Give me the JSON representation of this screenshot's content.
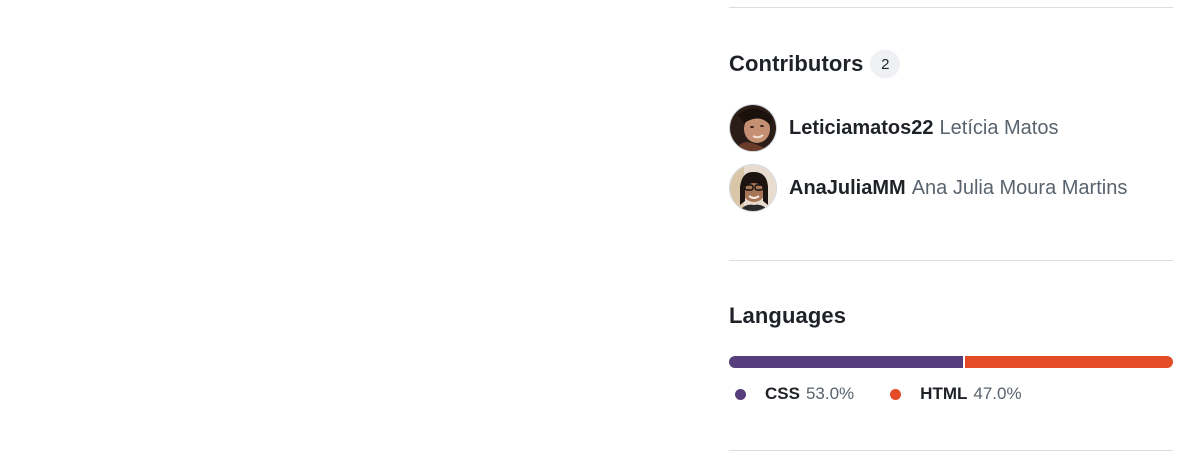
{
  "contributors": {
    "heading": "Contributors",
    "count": "2",
    "items": [
      {
        "login": "Leticiamatos22",
        "name": "Letícia Matos",
        "avatar_icon": "avatar-image"
      },
      {
        "login": "AnaJuliaMM",
        "name": "Ana Julia Moura Martins",
        "avatar_icon": "avatar-image"
      }
    ]
  },
  "languages": {
    "heading": "Languages",
    "items": [
      {
        "name": "CSS",
        "percent": "53.0%",
        "value": 53.0,
        "color": "#563d7c"
      },
      {
        "name": "HTML",
        "percent": "47.0%",
        "value": 47.0,
        "color": "#e34c26"
      }
    ]
  }
}
